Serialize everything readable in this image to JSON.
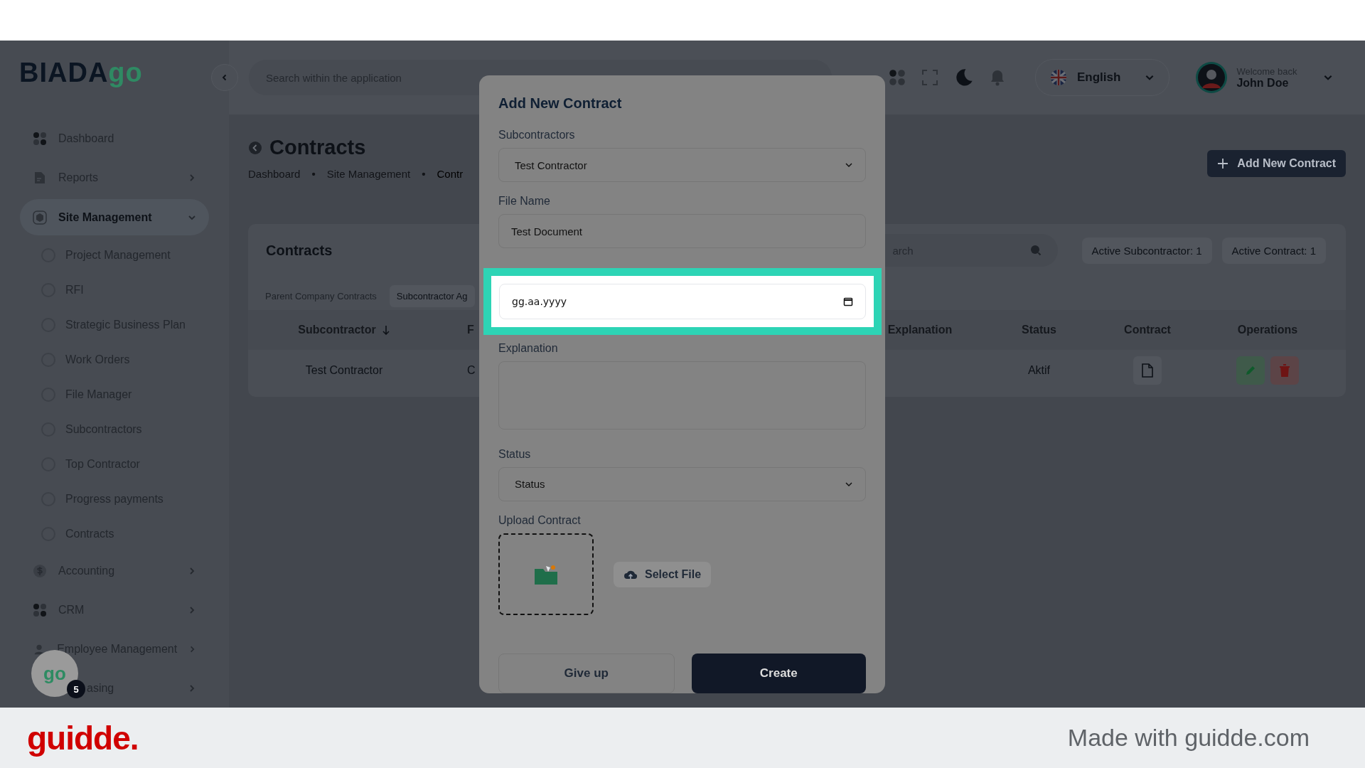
{
  "logo": {
    "text": "BIADA",
    "accent": "go"
  },
  "sidebar": {
    "items": [
      {
        "label": "Dashboard",
        "selected": false
      },
      {
        "label": "Reports",
        "selected": false,
        "expanded": false
      },
      {
        "label": "Site Management",
        "selected": true,
        "expanded": true,
        "children": [
          {
            "label": "Project Management"
          },
          {
            "label": "RFI"
          },
          {
            "label": "Strategic Business Plan"
          },
          {
            "label": "Work Orders"
          },
          {
            "label": "File Manager"
          },
          {
            "label": "Subcontractors"
          },
          {
            "label": "Top Contractor"
          },
          {
            "label": "Progress payments"
          },
          {
            "label": "Contracts"
          }
        ]
      },
      {
        "label": "Accounting",
        "selected": false,
        "expanded": false
      },
      {
        "label": "CRM",
        "selected": false,
        "expanded": false
      },
      {
        "label": "Employee Management",
        "selected": false,
        "expanded": false
      },
      {
        "label": "asing",
        "selected": false,
        "expanded": false
      }
    ]
  },
  "topbar": {
    "search": {
      "placeholder": "Search within the application"
    },
    "language": "English",
    "welcome": "Welcome back",
    "user": "John Doe"
  },
  "page": {
    "title": "Contracts",
    "breadcrumbs": [
      "Dashboard",
      "Site Management",
      "Contr"
    ],
    "separators": [
      "•",
      "•"
    ],
    "add_button": "Add New Contract"
  },
  "card": {
    "title": "Contracts",
    "search": {
      "placeholder": "arch"
    },
    "badges": [
      "Active Subcontractor: 1",
      "Active Contract: 1"
    ],
    "tabs": [
      {
        "label": "Parent Company Contracts",
        "selected": false
      },
      {
        "label": "Subcontractor Ag",
        "selected": true
      }
    ],
    "table": {
      "columns": [
        "Subcontractor",
        "F",
        "Explanation",
        "Status",
        "Contract",
        "Operations"
      ],
      "rows": [
        {
          "subcontractor": "Test Contractor",
          "column_2": "C",
          "status": "Aktif"
        }
      ]
    }
  },
  "modal": {
    "title": "Add New Contract",
    "subcontractors": {
      "label": "Subcontractors",
      "value": "Test Contractor"
    },
    "file_name": {
      "label": "File Name",
      "value": "Test Document"
    },
    "date": {
      "placeholder": "gg.aa.yyyy",
      "highlighted": true
    },
    "explanation": {
      "label": "Explanation"
    },
    "status": {
      "label": "Status",
      "value": "Status"
    },
    "upload": {
      "label": "Upload Contract",
      "button": "Select File"
    },
    "buttons": [
      "Give up",
      "Create"
    ]
  },
  "chat_bubble": {
    "logo": "go",
    "count": "5"
  },
  "footer": {
    "brand": "guidde.",
    "credit": "Made with guidde.com"
  }
}
